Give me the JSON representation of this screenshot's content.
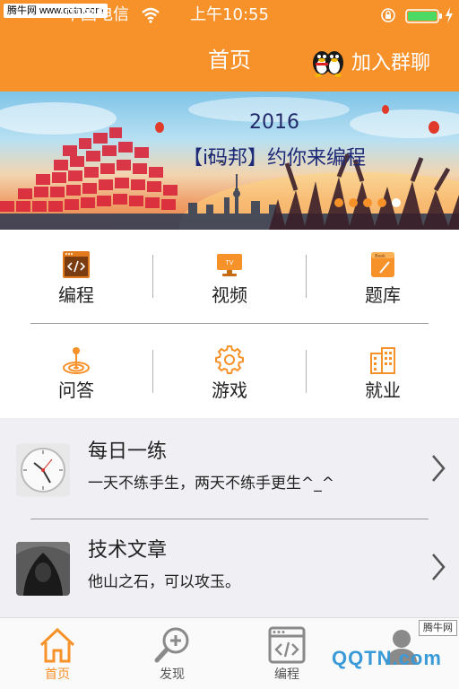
{
  "statusbar": {
    "watermark": "腾牛网 www.qqtn.com",
    "carrier": "中国电信",
    "time": "上午10:55"
  },
  "navbar": {
    "title": "首页",
    "join_label": "加入群聊",
    "join_icon": "qq-penguin-icon"
  },
  "banner": {
    "year": "2016",
    "text": "【i码邦】约你来编程",
    "pager_count": 5,
    "pager_active": 4
  },
  "grid": {
    "items": [
      {
        "label": "编程",
        "icon": "code-window-icon"
      },
      {
        "label": "视频",
        "icon": "tv-icon"
      },
      {
        "label": "题库",
        "icon": "book-icon"
      },
      {
        "label": "问答",
        "icon": "target-pin-icon"
      },
      {
        "label": "游戏",
        "icon": "gear-icon"
      },
      {
        "label": "就业",
        "icon": "building-icon"
      }
    ]
  },
  "list": {
    "items": [
      {
        "title": "每日一练",
        "subtitle": "一天不练手生，两天不练手更生^_^",
        "thumb": "clock-thumbnail"
      },
      {
        "title": "技术文章",
        "subtitle": "他山之石，可以攻玉。",
        "thumb": "hooded-person-thumbnail"
      }
    ]
  },
  "tabbar": {
    "tabs": [
      {
        "label": "首页",
        "icon": "home-icon",
        "active": true
      },
      {
        "label": "发现",
        "icon": "discover-search-icon",
        "active": false
      },
      {
        "label": "编程",
        "icon": "code-window-icon",
        "active": false
      },
      {
        "label": "",
        "icon": "profile-icon",
        "active": false
      }
    ],
    "watermark_logo": "QQTN.com",
    "watermark_box": "腾牛网"
  },
  "colors": {
    "accent": "#f7912a",
    "active_tab": "#f7912a",
    "inactive_tab": "#8a8a8a"
  }
}
